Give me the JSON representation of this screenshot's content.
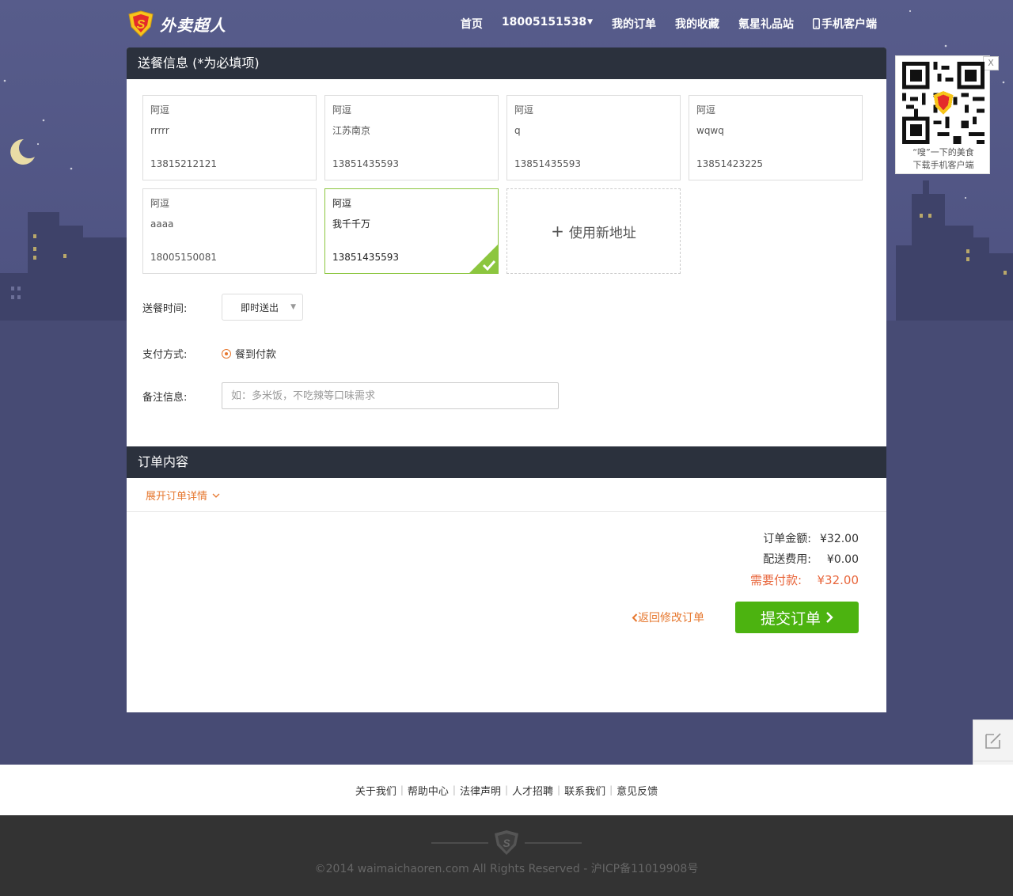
{
  "header": {
    "logo_text": "外卖超人",
    "nav": {
      "home": "首页",
      "account": "18005151538",
      "orders": "我的订单",
      "favorites": "我的收藏",
      "gift": "氪星礼品站",
      "mobile": "手机客户端"
    }
  },
  "delivery": {
    "title": "送餐信息 (*为必填项)",
    "addresses": [
      {
        "name": "阿逗",
        "street": "rrrrr",
        "phone": "13815212121"
      },
      {
        "name": "阿逗",
        "street": "江苏南京",
        "phone": "13851435593"
      },
      {
        "name": "阿逗",
        "street": "q",
        "phone": "13851435593"
      },
      {
        "name": "阿逗",
        "street": "wqwq",
        "phone": "13851423225"
      },
      {
        "name": "阿逗",
        "street": "aaaa",
        "phone": "18005150081"
      },
      {
        "name": "阿逗",
        "street": "我千千万",
        "phone": "13851435593"
      }
    ],
    "selected_index": 5,
    "new_address": "使用新地址",
    "time_label": "送餐时间:",
    "time_value": "即时送出",
    "payment_label": "支付方式:",
    "payment_value": "餐到付款",
    "note_label": "备注信息:",
    "note_placeholder": "如：多米饭，不吃辣等口味需求",
    "note_value": ""
  },
  "order": {
    "title": "订单内容",
    "expand_label": "展开订单详情",
    "amount_label": "订单金额:",
    "amount_value": "¥32.00",
    "delivery_fee_label": "配送费用:",
    "delivery_fee_value": "¥0.00",
    "due_label": "需要付款:",
    "due_value": "¥32.00",
    "back_label": "返回修改订单",
    "submit_label": "提交订单"
  },
  "qr": {
    "close": "X",
    "line1": "“嗖”一下的美食",
    "line2": "下载手机客户端"
  },
  "footer": {
    "links": [
      "关于我们",
      "帮助中心",
      "法律声明",
      "人才招聘",
      "联系我们",
      "意见反馈"
    ],
    "copyright": "©2014 waimaichaoren.com All Rights Reserved - 沪ICP备11019908号"
  },
  "colors": {
    "accent_orange": "#e6772e",
    "submit_green": "#4cb310",
    "selected_border": "#8cc63f",
    "header_dark": "#2b313d",
    "sky": "#4d5180"
  }
}
